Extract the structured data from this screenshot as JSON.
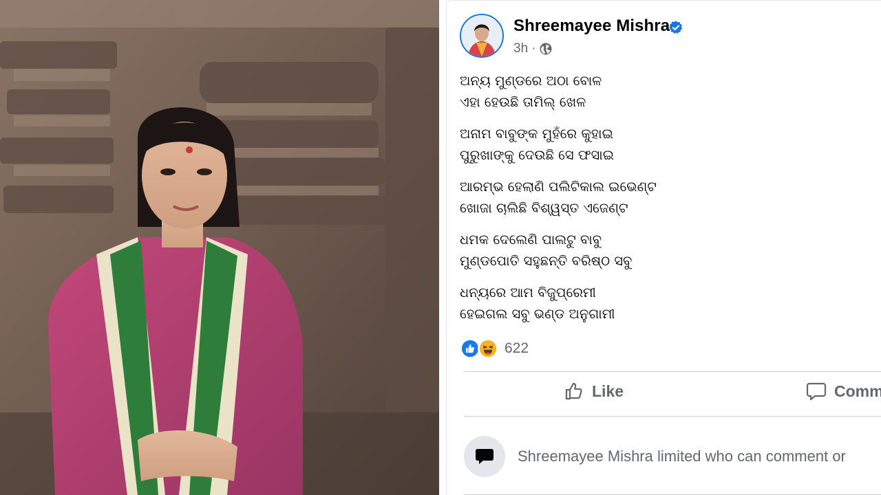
{
  "post": {
    "author": "Shreemayee Mishra",
    "verified": true,
    "time": "3h",
    "separator": "·",
    "privacy_icon": "globe-icon",
    "stanzas": [
      [
        "ଅନ୍ୟ ମୁଣ୍ଡରେ ଅଠା ବୋଳ",
        "ଏହା ହେଉଛି ତାମିଲ୍ ଖେଳ"
      ],
      [
        "ଅନାମ ବାବୁଙ୍କ ମୁହଁରେ କୁହାଇ",
        "ପୁରୁଖାଙ୍କୁ ଦେଉଛି ସେ ଫସାଇ"
      ],
      [
        "ଆରମ୍ଭ ହେଲାଣି ପଲିଟିକାଲ ଇଭେଣ୍ଟ",
        "ଖୋଜା ଚାଲିଛି ବିଶ୍ୱସ୍ତ ଏଜେଣ୍ଟ"
      ],
      [
        "ଧମକ ଦେଲେଣି ପାଲଟୁ ବାବୁ",
        "ମୁଣ୍ଡପୋତି ସହୁଛନ୍ତି ବରିଷ୍ଠ ସବୁ"
      ],
      [
        "ଧନ୍ୟରେ ଆମ ବିଜୁପ୍ରେମୀ",
        "ହେଇଗଲ ସବୁ ଭଣ୍ଡ ଅନୁଗାମୀ"
      ]
    ],
    "reactions": {
      "types": [
        "like",
        "haha"
      ],
      "count": "622"
    },
    "actions": {
      "like": "Like",
      "comment": "Comm"
    },
    "comment_notice": "Shreemayee Mishra limited who can comment or"
  },
  "colors": {
    "accent": "#1b74e4",
    "secondary_text": "#65676b",
    "primary_text": "#050505",
    "haha": "#f7b125"
  }
}
